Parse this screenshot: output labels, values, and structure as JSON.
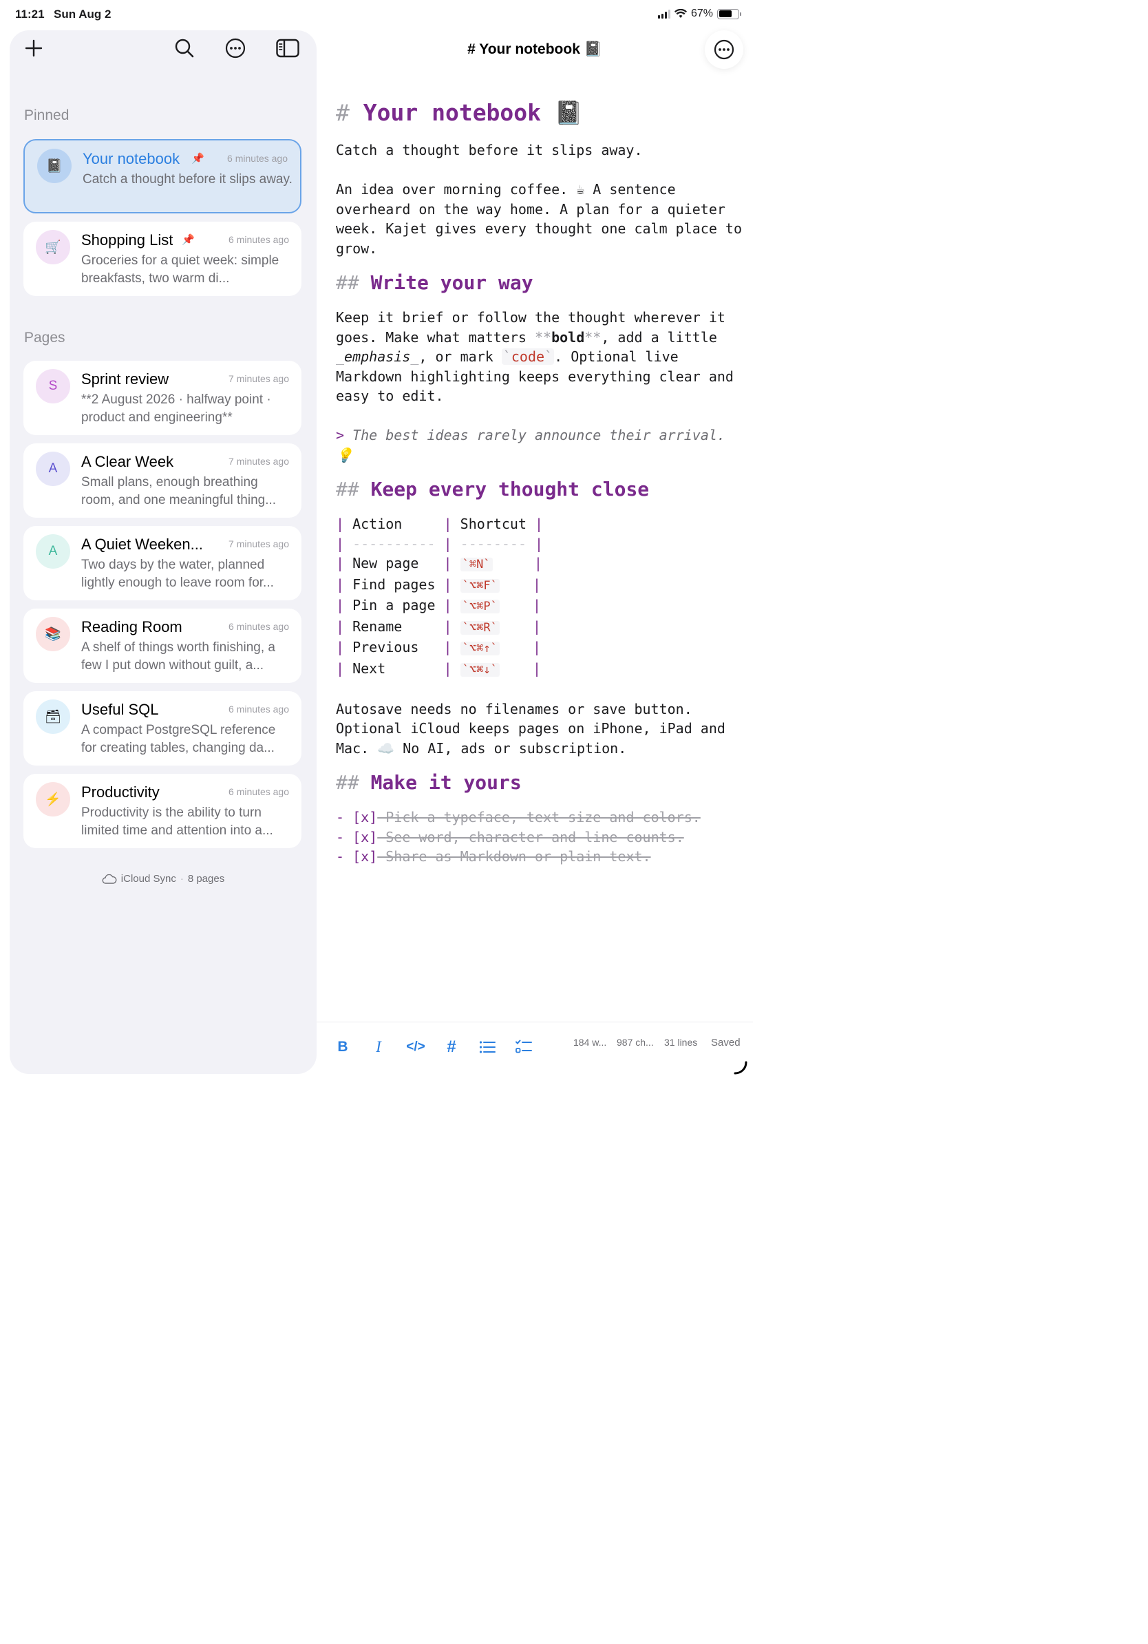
{
  "status": {
    "time": "11:21",
    "date": "Sun Aug 2",
    "battery": "67%",
    "battery_level": 0.67
  },
  "sidebar": {
    "pinned_label": "Pinned",
    "pages_label": "Pages",
    "pinned": [
      {
        "title": "Your notebook",
        "time": "6 minutes ago",
        "preview": "Catch a thought before it slips away.",
        "icon": "notebook-icon",
        "avatar": "📓",
        "avatar_bg": "#b9d3f2",
        "pinned": true,
        "active": true
      },
      {
        "title": "Shopping List",
        "time": "6 minutes ago",
        "preview": "Groceries for a quiet week: simple breakfasts, two warm di...",
        "icon": "cart-icon",
        "avatar": "🛒",
        "avatar_bg": "#f3e2f6",
        "pinned": true
      }
    ],
    "pages": [
      {
        "title": "Sprint review",
        "time": "7 minutes ago",
        "preview": "**2 August 2026 · halfway point · product and engineering**",
        "avatar": "S",
        "avatar_bg": "#f3e2f6",
        "avatar_color": "#b449c8"
      },
      {
        "title": "A Clear Week",
        "time": "7 minutes ago",
        "preview": "Small plans, enough breathing room, and one meaningful thing...",
        "avatar": "A",
        "avatar_bg": "#e6e6f8",
        "avatar_color": "#5a4fcf"
      },
      {
        "title": "A Quiet Weeken...",
        "time": "7 minutes ago",
        "preview": "Two days by the water, planned lightly enough to leave room for...",
        "avatar": "A",
        "avatar_bg": "#e0f5f1",
        "avatar_color": "#3fb89c"
      },
      {
        "title": "Reading Room",
        "time": "6 minutes ago",
        "preview": "A shelf of things worth finishing, a few I put down without guilt, a...",
        "avatar": "📚",
        "avatar_bg": "#fbe3e3"
      },
      {
        "title": "Useful SQL",
        "time": "6 minutes ago",
        "preview": "A compact PostgreSQL reference for creating tables, changing da...",
        "avatar": "🗃",
        "avatar_bg": "#dff1fb"
      },
      {
        "title": "Productivity",
        "time": "6 minutes ago",
        "preview": "Productivity is the ability to turn limited time and attention into a...",
        "avatar": "⚡",
        "avatar_bg": "#fbe3e3"
      }
    ],
    "sync_label": "iCloud Sync",
    "sync_dot": "·",
    "page_count": "8 pages"
  },
  "editor": {
    "header_title": "# Your notebook 📓",
    "h1_mark": "#",
    "h1_text": "Your notebook 📓",
    "p1": "Catch a thought before it slips away.",
    "p2": "An idea over morning coffee. ☕ A sentence overheard on the way home. A plan for a quieter week. Kajet gives every thought one calm place to grow.",
    "h2_mark": "##",
    "h2a": "Write your way",
    "p3_a": "Keep it brief or follow the thought wherever it goes. Make what matters ",
    "p3_bold_mark": "**",
    "p3_bold": "bold",
    "p3_b": ", add a little ",
    "p3_em_mark": "_",
    "p3_em": "emphasis",
    "p3_c": ", or mark ",
    "p3_code_mark": "`",
    "p3_code": "code",
    "p3_d": ". Optional live Markdown highlighting keeps everything clear and easy to edit.",
    "quote_mark": ">",
    "quote": "The best ideas rarely announce their arrival. 💡",
    "h2b": "Keep every thought close",
    "table_pipe": "|",
    "table_head": [
      "Action",
      "Shortcut"
    ],
    "table_sep": [
      "----------",
      "--------"
    ],
    "table_rows": [
      {
        "action": "New page",
        "key": "⌘N"
      },
      {
        "action": "Find pages",
        "key": "⌥⌘F"
      },
      {
        "action": "Pin a page",
        "key": "⌥⌘P"
      },
      {
        "action": "Rename",
        "key": "⌥⌘R"
      },
      {
        "action": "Previous",
        "key": "⌥⌘↑"
      },
      {
        "action": "Next",
        "key": "⌥⌘↓"
      }
    ],
    "p4": "Autosave needs no filenames or save button. Optional iCloud keeps pages on iPhone, iPad and Mac. ☁️ No AI, ads or subscription.",
    "h2c": "Make it yours",
    "task_mark": "- [x]",
    "tasks": [
      "Pick a typeface, text size and colors.",
      "See word, character and line counts.",
      "Share as Markdown or plain text."
    ]
  },
  "bottom": {
    "bold": "B",
    "italic": "I",
    "code": "</>",
    "heading": "#",
    "words": "184 w...",
    "chars": "987 ch...",
    "lines": "31 lines",
    "saved": "Saved"
  },
  "colors": {
    "accent": "#2b7fe0",
    "markdown": "#7a2a8c",
    "code": "#c0392b"
  }
}
